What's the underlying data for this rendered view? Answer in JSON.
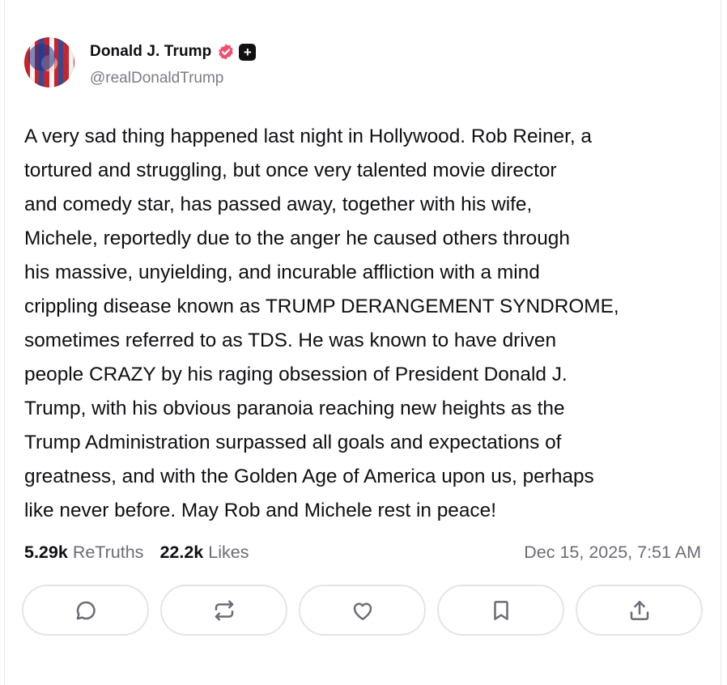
{
  "post": {
    "author": {
      "display_name": "Donald J. Trump",
      "handle": "@realDonaldTrump",
      "verified_badge_icon": "verified-badge-icon",
      "plus_badge_icon": "plus-badge-icon",
      "plus_badge_symbol": "+",
      "accent_color": "#f0506e"
    },
    "text": "A very sad thing happened last night in Hollywood. Rob Reiner, a\ntortured and struggling, but once very talented movie director\nand comedy star, has passed away, together with his wife,\nMichele, reportedly due to the anger he caused others through\nhis massive, unyielding, and incurable affliction with a mind\ncrippling disease known as TRUMP DERANGEMENT SYNDROME,\nsometimes referred to as TDS. He was known to have driven\npeople CRAZY by his raging obsession of President Donald J.\nTrump, with his obvious paranoia reaching new heights as the\nTrump Administration surpassed all goals and expectations of\ngreatness, and with the Golden Age of America upon us, perhaps\nlike never before. May Rob and Michele rest in peace!",
    "stats": {
      "retruths_count": "5.29k",
      "retruths_label": "ReTruths",
      "likes_count": "22.2k",
      "likes_label": "Likes",
      "timestamp": "Dec 15, 2025, 7:51 AM"
    },
    "actions": [
      {
        "name": "reply",
        "icon": "comment-icon"
      },
      {
        "name": "retruth",
        "icon": "repost-icon"
      },
      {
        "name": "like",
        "icon": "heart-icon"
      },
      {
        "name": "bookmark",
        "icon": "bookmark-icon"
      },
      {
        "name": "share",
        "icon": "share-icon"
      }
    ]
  }
}
